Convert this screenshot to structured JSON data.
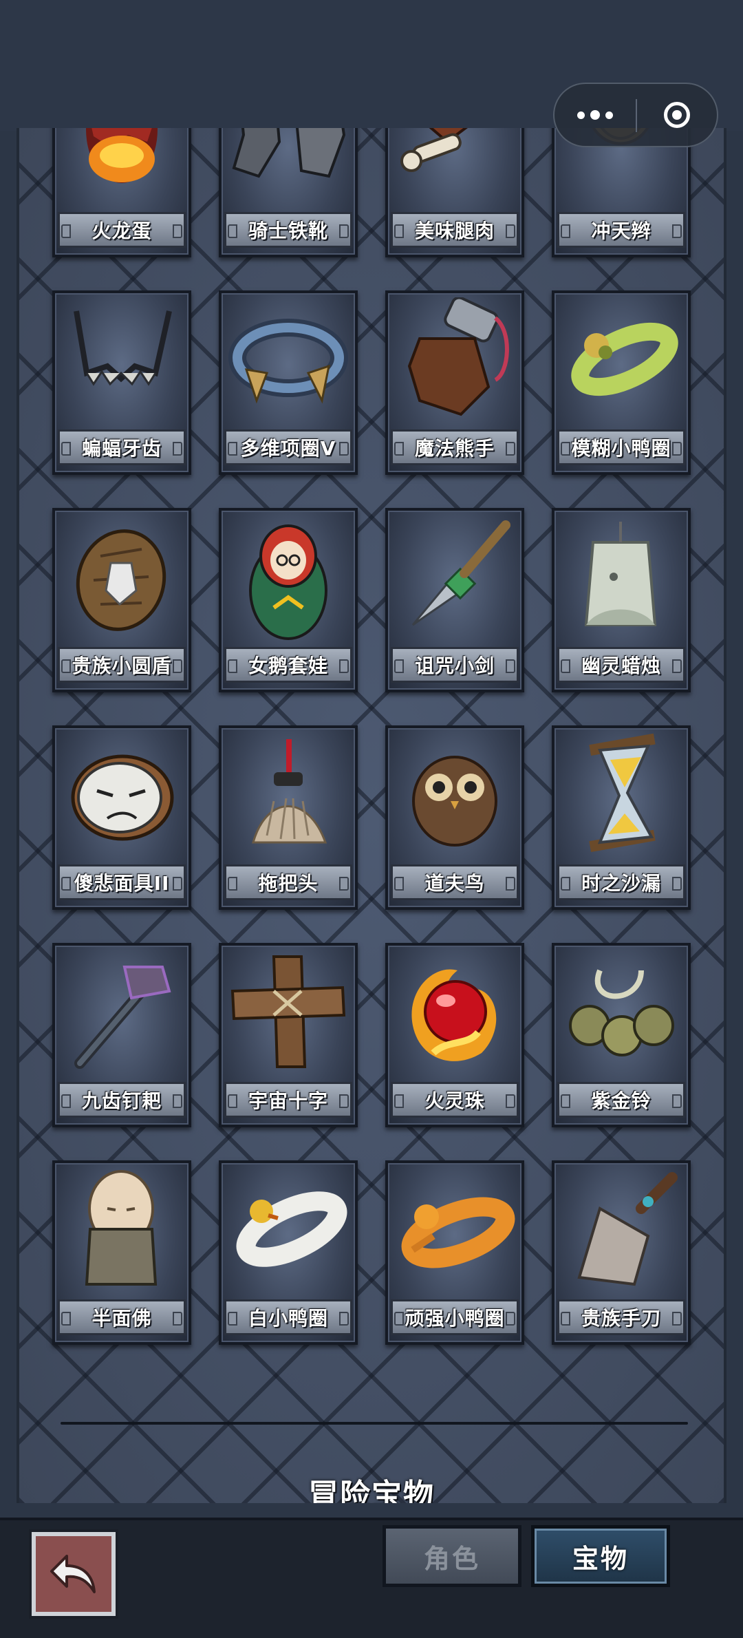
{
  "capsule": {
    "more_icon": "more-dots-icon",
    "close_icon": "target-circle-icon"
  },
  "items": [
    {
      "name": "火龙蛋",
      "icon": "lava-egg-icon"
    },
    {
      "name": "骑士铁靴",
      "icon": "iron-boots-icon"
    },
    {
      "name": "美味腿肉",
      "icon": "meat-leg-icon"
    },
    {
      "name": "冲天辫",
      "icon": "pigtail-icon"
    },
    {
      "name": "蝙蝠牙齿",
      "icon": "bat-fangs-icon"
    },
    {
      "name": "多维项圈V",
      "icon": "collar-icon"
    },
    {
      "name": "魔法熊手",
      "icon": "bear-paw-icon"
    },
    {
      "name": "模糊小鸭圈",
      "icon": "blurry-duck-ring-icon"
    },
    {
      "name": "贵族小圆盾",
      "icon": "round-shield-icon"
    },
    {
      "name": "女鹅套娃",
      "icon": "matryoshka-doll-icon"
    },
    {
      "name": "诅咒小剑",
      "icon": "cursed-dagger-icon"
    },
    {
      "name": "幽灵蜡烛",
      "icon": "ghost-candle-icon"
    },
    {
      "name": "傻悲面具II",
      "icon": "sad-mask-icon"
    },
    {
      "name": "拖把头",
      "icon": "mop-head-icon"
    },
    {
      "name": "道夫鸟",
      "icon": "owl-icon"
    },
    {
      "name": "时之沙漏",
      "icon": "hourglass-icon"
    },
    {
      "name": "九齿钉耙",
      "icon": "nine-tooth-rake-icon"
    },
    {
      "name": "宇宙十字",
      "icon": "wooden-cross-icon"
    },
    {
      "name": "火灵珠",
      "icon": "fire-orb-icon"
    },
    {
      "name": "紫金铃",
      "icon": "purple-gold-bells-icon"
    },
    {
      "name": "半面佛",
      "icon": "half-buddha-icon"
    },
    {
      "name": "白小鸭圈",
      "icon": "white-duck-ring-icon"
    },
    {
      "name": "顽强小鸭圈",
      "icon": "orange-duck-ring-icon"
    },
    {
      "name": "贵族手刀",
      "icon": "cleaver-icon"
    }
  ],
  "footer": {
    "title": "冒险宝物"
  },
  "nav": {
    "back_icon": "back-arrow-icon",
    "tabs": [
      {
        "label": "角色",
        "active": false
      },
      {
        "label": "宝物",
        "active": true
      }
    ]
  }
}
